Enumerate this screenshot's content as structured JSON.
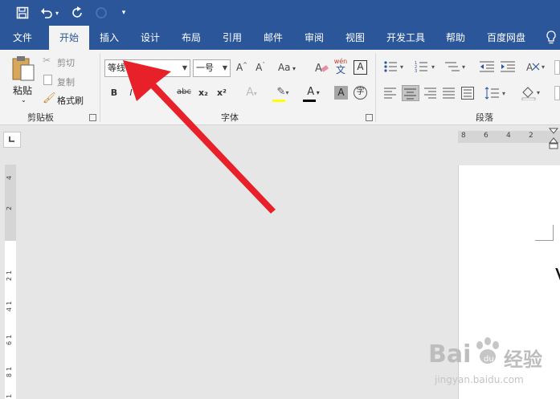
{
  "tabs": [
    "文件",
    "开始",
    "插入",
    "设计",
    "布局",
    "引用",
    "邮件",
    "审阅",
    "视图",
    "开发工具",
    "帮助",
    "百度网盘"
  ],
  "active_tab": "开始",
  "clipboard": {
    "paste": "粘贴",
    "cut": "剪切",
    "copy": "复制",
    "format_painter": "格式刷",
    "group": "剪贴板"
  },
  "font": {
    "name": "等线",
    "size": "一号",
    "group": "字体",
    "bold": "B",
    "italic": "I",
    "strike": "abc",
    "sub": "x₂",
    "sup": "x²",
    "case": "Aa",
    "grow": "A^",
    "shrink": "Aˇ",
    "phonetic_top": "wén",
    "phonetic_bottom": "文",
    "border_char": "A",
    "color_a": "A",
    "shade_a": "A",
    "enclose": "字"
  },
  "paragraph": {
    "group": "段落"
  },
  "ruler": {
    "horizontal": [
      "8",
      "6",
      "4",
      "2"
    ],
    "vertical": [
      "4",
      "2",
      "1",
      "2",
      "1",
      "4",
      "1",
      "6",
      "1",
      "8",
      "1"
    ]
  },
  "watermark": {
    "brand": "Bai",
    "brand2": "经验",
    "url": "jingyan.baidu.com"
  },
  "colors": {
    "ribbon_blue": "#2b579a",
    "ribbon_bg": "#f3f3f3",
    "arrow": "#e8202a",
    "font_color_bar": "#000000"
  }
}
